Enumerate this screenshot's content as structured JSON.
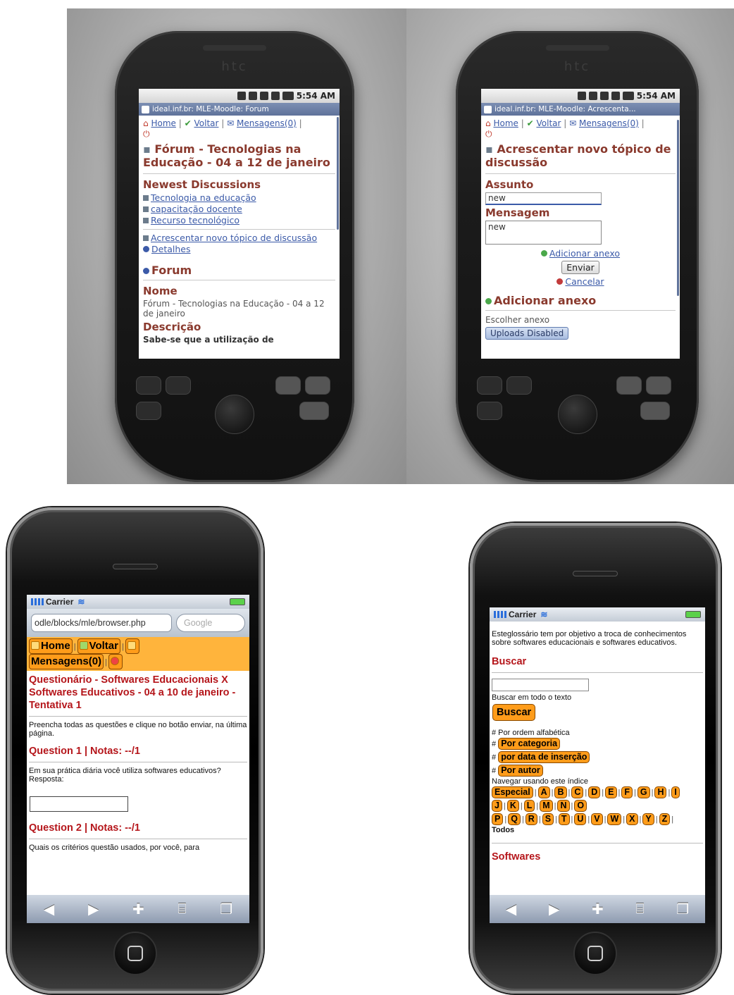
{
  "htc_left": {
    "status_time": "5:54 AM",
    "title": "ideal.inf.br: MLE-Moodle: Forum",
    "brand": "htc",
    "nav": {
      "home": "Home",
      "back": "Voltar",
      "messages": "Mensagens(0)"
    },
    "heading": "Fórum - Tecnologias na Educação - 04 a 12 de janeiro",
    "newest_title": "Newest Discussions",
    "discussions": [
      "Tecnologia na educação",
      "capacitação docente",
      "Recurso tecnológico"
    ],
    "add_topic": "Acrescentar novo tópico de discussão",
    "details": "Detalhes",
    "forum_heading": "Forum",
    "name_label": "Nome",
    "name_value": "Fórum - Tecnologias na Educação - 04 a 12 de janeiro",
    "desc_label": "Descrição",
    "desc_value": "Sabe-se que a utilização de"
  },
  "htc_right": {
    "status_time": "5:54 AM",
    "title": "ideal.inf.br: MLE-Moodle: Acrescenta...",
    "brand": "htc",
    "nav": {
      "home": "Home",
      "back": "Voltar",
      "messages": "Mensagens(0)"
    },
    "heading": "Acrescentar novo tópico de discussão",
    "subject_label": "Assunto",
    "subject_value": "new",
    "message_label": "Mensagem",
    "message_value": "new",
    "add_attachment_link": "Adicionar anexo",
    "send_button": "Enviar",
    "cancel_link": "Cancelar",
    "add_attachment_heading": "Adicionar anexo",
    "choose_attachment": "Escolher anexo",
    "uploads_disabled": "Uploads Disabled"
  },
  "iphone_left": {
    "carrier": "Carrier",
    "url": "odle/blocks/mle/browser.php",
    "search_placeholder": "Google",
    "nav": {
      "home": "Home",
      "back": "Voltar",
      "messages": "Mensagens(0)"
    },
    "heading": "Questionário - Softwares Educacionais X Softwares Educativos - 04 a 10 de janeiro - Tentativa 1",
    "instructions": "Preencha todas as questões e clique no botão enviar, na última página.",
    "q1_heading": "Question 1 | Notas: --/1",
    "q1_text": "Em sua prática diária você utiliza softwares educativos?",
    "q1_answer_label": "Resposta:",
    "q2_heading": "Question 2 | Notas: --/1",
    "q2_text": "Quais os critérios questão usados, por você, para"
  },
  "iphone_right": {
    "carrier": "Carrier",
    "intro": "Esteglossário tem por objetivo a troca de conhecimentos sobre softwares educacionais e softwares educativos.",
    "search_heading": "Buscar",
    "search_all_text": "Buscar em todo o texto",
    "search_button": "Buscar",
    "order_alpha": "# Por ordem alfabética",
    "order_category": "Por categoria",
    "order_date": "por data de inserção",
    "order_author": "Por autor",
    "browse_index": "Navegar usando este índice",
    "special": "Especial",
    "letters_row1": [
      "A",
      "B",
      "C",
      "D",
      "E",
      "F",
      "G",
      "H",
      "I"
    ],
    "letters_row2": [
      "J",
      "K",
      "L",
      "M",
      "N",
      "O"
    ],
    "letters_row3": [
      "P",
      "Q",
      "R",
      "S",
      "T",
      "U",
      "V",
      "W",
      "X",
      "Y",
      "Z"
    ],
    "all": "Todos",
    "cut_heading": "Softwares"
  },
  "icons": {
    "toolbar": [
      "back-arrow-icon",
      "forward-arrow-icon",
      "plus-icon",
      "bookmarks-icon",
      "pages-icon"
    ]
  }
}
